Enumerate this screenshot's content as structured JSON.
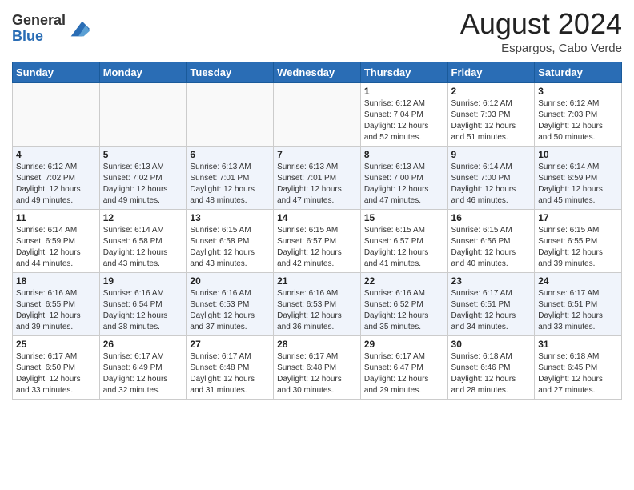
{
  "header": {
    "logo_general": "General",
    "logo_blue": "Blue",
    "month_year": "August 2024",
    "location": "Espargos, Cabo Verde"
  },
  "days_of_week": [
    "Sunday",
    "Monday",
    "Tuesday",
    "Wednesday",
    "Thursday",
    "Friday",
    "Saturday"
  ],
  "weeks": [
    [
      {
        "day": "",
        "info": ""
      },
      {
        "day": "",
        "info": ""
      },
      {
        "day": "",
        "info": ""
      },
      {
        "day": "",
        "info": ""
      },
      {
        "day": "1",
        "info": "Sunrise: 6:12 AM\nSunset: 7:04 PM\nDaylight: 12 hours\nand 52 minutes."
      },
      {
        "day": "2",
        "info": "Sunrise: 6:12 AM\nSunset: 7:03 PM\nDaylight: 12 hours\nand 51 minutes."
      },
      {
        "day": "3",
        "info": "Sunrise: 6:12 AM\nSunset: 7:03 PM\nDaylight: 12 hours\nand 50 minutes."
      }
    ],
    [
      {
        "day": "4",
        "info": "Sunrise: 6:12 AM\nSunset: 7:02 PM\nDaylight: 12 hours\nand 49 minutes."
      },
      {
        "day": "5",
        "info": "Sunrise: 6:13 AM\nSunset: 7:02 PM\nDaylight: 12 hours\nand 49 minutes."
      },
      {
        "day": "6",
        "info": "Sunrise: 6:13 AM\nSunset: 7:01 PM\nDaylight: 12 hours\nand 48 minutes."
      },
      {
        "day": "7",
        "info": "Sunrise: 6:13 AM\nSunset: 7:01 PM\nDaylight: 12 hours\nand 47 minutes."
      },
      {
        "day": "8",
        "info": "Sunrise: 6:13 AM\nSunset: 7:00 PM\nDaylight: 12 hours\nand 47 minutes."
      },
      {
        "day": "9",
        "info": "Sunrise: 6:14 AM\nSunset: 7:00 PM\nDaylight: 12 hours\nand 46 minutes."
      },
      {
        "day": "10",
        "info": "Sunrise: 6:14 AM\nSunset: 6:59 PM\nDaylight: 12 hours\nand 45 minutes."
      }
    ],
    [
      {
        "day": "11",
        "info": "Sunrise: 6:14 AM\nSunset: 6:59 PM\nDaylight: 12 hours\nand 44 minutes."
      },
      {
        "day": "12",
        "info": "Sunrise: 6:14 AM\nSunset: 6:58 PM\nDaylight: 12 hours\nand 43 minutes."
      },
      {
        "day": "13",
        "info": "Sunrise: 6:15 AM\nSunset: 6:58 PM\nDaylight: 12 hours\nand 43 minutes."
      },
      {
        "day": "14",
        "info": "Sunrise: 6:15 AM\nSunset: 6:57 PM\nDaylight: 12 hours\nand 42 minutes."
      },
      {
        "day": "15",
        "info": "Sunrise: 6:15 AM\nSunset: 6:57 PM\nDaylight: 12 hours\nand 41 minutes."
      },
      {
        "day": "16",
        "info": "Sunrise: 6:15 AM\nSunset: 6:56 PM\nDaylight: 12 hours\nand 40 minutes."
      },
      {
        "day": "17",
        "info": "Sunrise: 6:15 AM\nSunset: 6:55 PM\nDaylight: 12 hours\nand 39 minutes."
      }
    ],
    [
      {
        "day": "18",
        "info": "Sunrise: 6:16 AM\nSunset: 6:55 PM\nDaylight: 12 hours\nand 39 minutes."
      },
      {
        "day": "19",
        "info": "Sunrise: 6:16 AM\nSunset: 6:54 PM\nDaylight: 12 hours\nand 38 minutes."
      },
      {
        "day": "20",
        "info": "Sunrise: 6:16 AM\nSunset: 6:53 PM\nDaylight: 12 hours\nand 37 minutes."
      },
      {
        "day": "21",
        "info": "Sunrise: 6:16 AM\nSunset: 6:53 PM\nDaylight: 12 hours\nand 36 minutes."
      },
      {
        "day": "22",
        "info": "Sunrise: 6:16 AM\nSunset: 6:52 PM\nDaylight: 12 hours\nand 35 minutes."
      },
      {
        "day": "23",
        "info": "Sunrise: 6:17 AM\nSunset: 6:51 PM\nDaylight: 12 hours\nand 34 minutes."
      },
      {
        "day": "24",
        "info": "Sunrise: 6:17 AM\nSunset: 6:51 PM\nDaylight: 12 hours\nand 33 minutes."
      }
    ],
    [
      {
        "day": "25",
        "info": "Sunrise: 6:17 AM\nSunset: 6:50 PM\nDaylight: 12 hours\nand 33 minutes."
      },
      {
        "day": "26",
        "info": "Sunrise: 6:17 AM\nSunset: 6:49 PM\nDaylight: 12 hours\nand 32 minutes."
      },
      {
        "day": "27",
        "info": "Sunrise: 6:17 AM\nSunset: 6:48 PM\nDaylight: 12 hours\nand 31 minutes."
      },
      {
        "day": "28",
        "info": "Sunrise: 6:17 AM\nSunset: 6:48 PM\nDaylight: 12 hours\nand 30 minutes."
      },
      {
        "day": "29",
        "info": "Sunrise: 6:17 AM\nSunset: 6:47 PM\nDaylight: 12 hours\nand 29 minutes."
      },
      {
        "day": "30",
        "info": "Sunrise: 6:18 AM\nSunset: 6:46 PM\nDaylight: 12 hours\nand 28 minutes."
      },
      {
        "day": "31",
        "info": "Sunrise: 6:18 AM\nSunset: 6:45 PM\nDaylight: 12 hours\nand 27 minutes."
      }
    ]
  ]
}
